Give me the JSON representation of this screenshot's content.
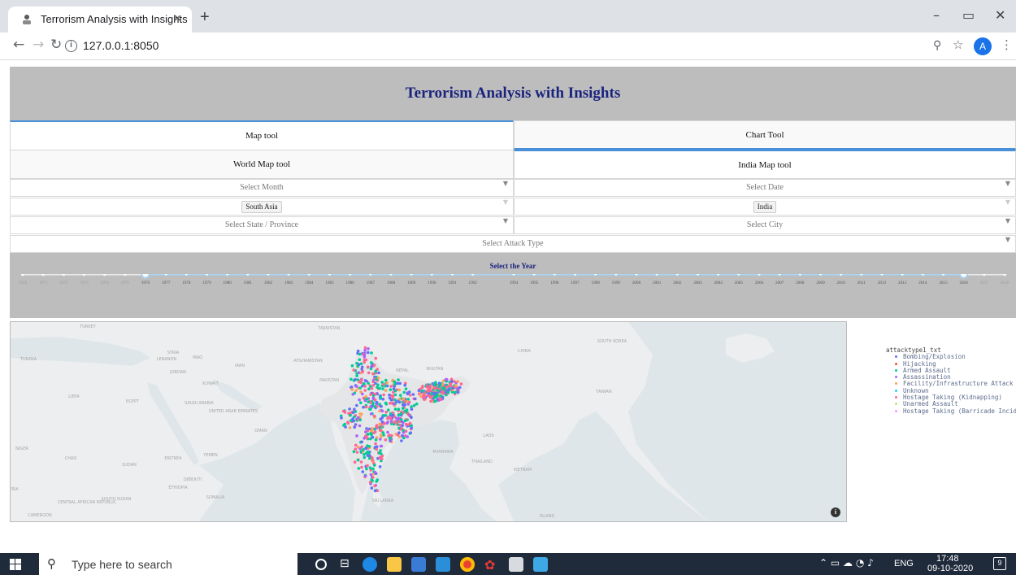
{
  "browser": {
    "tab_title": "Terrorism Analysis with Insights",
    "tab_close": "×",
    "new_tab": "+",
    "url": "127.0.0.1:8050",
    "avatar_letter": "A",
    "icons": [
      "favicon-icon",
      "back-icon",
      "forward-icon",
      "reload-icon",
      "info-icon",
      "zoom-icon",
      "bookmark-star-icon",
      "menu-icon",
      "minimize-icon",
      "maximize-icon",
      "close-window-icon"
    ]
  },
  "page": {
    "title": "Terrorism Analysis with Insights",
    "tabs": {
      "map": "Map tool",
      "chart": "Chart Tool"
    },
    "subtabs": {
      "world": "World Map tool",
      "india": "India Map tool"
    },
    "filters": {
      "month_placeholder": "Select Month",
      "date_placeholder": "Select Date",
      "region_value": "South Asia",
      "country_value": "India",
      "state_placeholder": "Select State / Province",
      "city_placeholder": "Select City",
      "attack_placeholder": "Select Attack Type"
    },
    "year_slider": {
      "label": "Select the Year",
      "years": [
        "1970",
        "1971",
        "1972",
        "1973",
        "1974",
        "1975",
        "1976",
        "1977",
        "1978",
        "1979",
        "1980",
        "1981",
        "1982",
        "1983",
        "1984",
        "1985",
        "1986",
        "1987",
        "1988",
        "1989",
        "1990",
        "1991",
        "1992",
        "1994",
        "1995",
        "1996",
        "1997",
        "1998",
        "1999",
        "2000",
        "2001",
        "2002",
        "2003",
        "2004",
        "2005",
        "2006",
        "2007",
        "2008",
        "2009",
        "2010",
        "2011",
        "2012",
        "2013",
        "2014",
        "2015",
        "2016",
        "2017",
        "2018"
      ],
      "range": [
        "1976",
        "2016"
      ]
    },
    "map": {
      "country_labels": [
        "TURKEY",
        "TAJIKISTAN",
        "SOUTH KOREA",
        "TUNISIA",
        "SYRIA",
        "LEBANON",
        "IRAQ",
        "IRAN",
        "AFGHANISTAN",
        "CHINA",
        "JORDAN",
        "KUWAIT",
        "PAKISTAN",
        "NEPAL",
        "BHUTAN",
        "LIBYA",
        "EGYPT",
        "SAUDI ARABIA",
        "UNITED ARAB EMIRATES",
        "TAIWAN",
        "OMAN",
        "LAOS",
        "NIGER",
        "CHAD",
        "ERITREA",
        "YEMEN",
        "MYANMAR",
        "SUDAN",
        "THAILAND",
        "VIETNAM",
        "DJIBOUTI",
        "ETHIOPIA",
        "SOMALIA",
        "CENTRAL AFRICAN REPUBLIC",
        "SOUTH SUDAN",
        "CAMEROON",
        "SRI LANKA",
        "ISLAND",
        "GERIA"
      ],
      "info_icon": "i"
    },
    "legend": {
      "title": "attacktype1_txt",
      "items": [
        {
          "label": "Bombing/Explosion",
          "color": "#636efa"
        },
        {
          "label": "Hijacking",
          "color": "#ef553b"
        },
        {
          "label": "Armed Assault",
          "color": "#00cc96"
        },
        {
          "label": "Assassination",
          "color": "#ab63fa"
        },
        {
          "label": "Facility/Infrastructure Attack",
          "color": "#ffa15a"
        },
        {
          "label": "Unknown",
          "color": "#19d3f3"
        },
        {
          "label": "Hostage Taking (Kidnapping)",
          "color": "#ff6692"
        },
        {
          "label": "Unarmed Assault",
          "color": "#b6e880"
        },
        {
          "label": "Hostage Taking (Barricade Incident)",
          "color": "#ff97ff"
        }
      ]
    }
  },
  "taskbar": {
    "search_placeholder": "Type here to search",
    "language": "ENG",
    "time": "17:48",
    "date": "09-10-2020",
    "notification_count": "9"
  }
}
